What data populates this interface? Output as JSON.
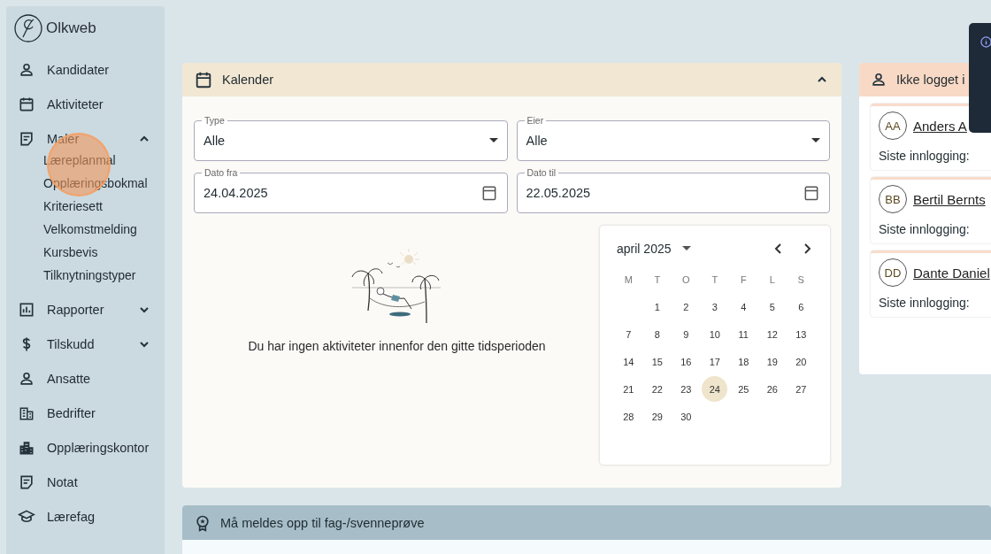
{
  "logo": {
    "text": "Olkweb"
  },
  "sidebar": {
    "items": [
      {
        "label": "Kandidater"
      },
      {
        "label": "Aktiviteter"
      },
      {
        "label": "Maler",
        "expanded": true,
        "children": [
          {
            "label": "Læreplanmal"
          },
          {
            "label": "Opplæringsbokmal"
          },
          {
            "label": "Kriteriesett"
          },
          {
            "label": "Velkomstmelding"
          },
          {
            "label": "Kursbevis"
          },
          {
            "label": "Tilknytningstyper"
          }
        ]
      },
      {
        "label": "Rapporter",
        "expanded": false
      },
      {
        "label": "Tilskudd",
        "expanded": false
      },
      {
        "label": "Ansatte"
      },
      {
        "label": "Bedrifter"
      },
      {
        "label": "Opplæringskontor"
      },
      {
        "label": "Notat"
      },
      {
        "label": "Lærefag"
      }
    ]
  },
  "calendar_panel": {
    "title": "Kalender",
    "expanded": true,
    "fields": [
      {
        "kind": "select",
        "label": "Type",
        "value": "Alle"
      },
      {
        "kind": "select",
        "label": "Eier",
        "value": "Alle"
      },
      {
        "kind": "date",
        "label": "Dato fra",
        "value": "24.04.2025"
      },
      {
        "kind": "date",
        "label": "Dato til",
        "value": "22.05.2025"
      }
    ],
    "empty_message": "Du har ingen aktiviteter innenfor den gitte tidsperioden",
    "date_picker": {
      "month": "april 2025",
      "weekdays": [
        "M",
        "T",
        "O",
        "T",
        "F",
        "L",
        "S"
      ],
      "weeks": [
        {
          "kind": "leading",
          "days": [
            {
              "day": "1",
              "selected": false
            },
            {
              "day": "2",
              "selected": false
            },
            {
              "day": "3",
              "selected": false
            },
            {
              "day": "4",
              "selected": false
            },
            {
              "day": "5",
              "selected": false
            },
            {
              "day": "6",
              "selected": false
            }
          ]
        },
        {
          "kind": "full",
          "days": [
            {
              "day": "7",
              "selected": false
            },
            {
              "day": "8",
              "selected": false
            },
            {
              "day": "9",
              "selected": false
            },
            {
              "day": "10",
              "selected": false
            },
            {
              "day": "11",
              "selected": false
            },
            {
              "day": "12",
              "selected": false
            },
            {
              "day": "13",
              "selected": false
            }
          ]
        },
        {
          "kind": "full",
          "days": [
            {
              "day": "14",
              "selected": false
            },
            {
              "day": "15",
              "selected": false
            },
            {
              "day": "16",
              "selected": false
            },
            {
              "day": "17",
              "selected": false
            },
            {
              "day": "18",
              "selected": false
            },
            {
              "day": "19",
              "selected": false
            },
            {
              "day": "20",
              "selected": false
            }
          ]
        },
        {
          "kind": "full",
          "days": [
            {
              "day": "21",
              "selected": false
            },
            {
              "day": "22",
              "selected": false
            },
            {
              "day": "23",
              "selected": false
            },
            {
              "day": "24",
              "selected": true
            },
            {
              "day": "25",
              "selected": false
            },
            {
              "day": "26",
              "selected": false
            },
            {
              "day": "27",
              "selected": false
            }
          ]
        },
        {
          "kind": "trailing",
          "days": [
            {
              "day": "28",
              "selected": false
            },
            {
              "day": "29",
              "selected": false
            },
            {
              "day": "30",
              "selected": false
            }
          ]
        }
      ]
    }
  },
  "not_logged_in_panel": {
    "title": "Ikke logget i",
    "people": [
      {
        "initials": "AA",
        "name": "Anders A",
        "last_login_label": "Siste innlogging:"
      },
      {
        "initials": "BB",
        "name": "Bertil Bernts",
        "last_login_label": "Siste innlogging:"
      },
      {
        "initials": "DD",
        "name": "Dante Daniel",
        "last_login_label": "Siste innlogging:"
      }
    ]
  },
  "exam_panel": {
    "title": "Må meldes opp til fag-/svenneprøve"
  }
}
